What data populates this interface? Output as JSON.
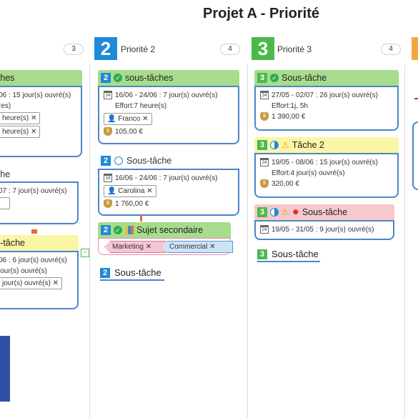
{
  "title": "Projet A - Priorité",
  "columns": [
    {
      "label": "",
      "count": "3"
    },
    {
      "badge": "2",
      "label": "Priorité 2",
      "count": "4"
    },
    {
      "badge": "3",
      "label": "Priorité 3",
      "count": "4"
    }
  ],
  "col1": {
    "card1": {
      "title": "ches",
      "dates": "06 : 15 jour(s) ouvré(s)",
      "line2": "res)",
      "chip1": "heure(s)",
      "chip2": "heure(s)"
    },
    "card2": {
      "title": "che",
      "dates": "07 : 7 jour(s) ouvré(s)"
    },
    "card3": {
      "title": "s-tâche",
      "dates": "06 : 6 jour(s) ouvré(s)",
      "line2": "jour(s) ouvré(s)",
      "chip": "jour(s) ouvré(s)"
    }
  },
  "col2": {
    "card1": {
      "badge": "2",
      "title": "sous-tâches",
      "dates": "16/06 - 24/06 : 7 jour(s) ouvré(s)",
      "effort": "Effort:7 heure(s)",
      "person": "Franco",
      "cost": "105,00 €"
    },
    "card2": {
      "badge": "2",
      "title": "Sous-tâche",
      "dates": "16/06 - 24/06 : 7 jour(s) ouvré(s)",
      "person": "Carolina",
      "cost": "1 760,00 €"
    },
    "card3": {
      "badge": "2",
      "title": "Sujet secondaire",
      "tag1": "Marketing",
      "tag2": "Commercial"
    },
    "plain": {
      "badge": "2",
      "title": "Sous-tâche"
    }
  },
  "col3": {
    "card1": {
      "badge": "3",
      "title": "Sous-tâche",
      "dates": "27/05 - 02/07 : 26 jour(s) ouvré(s)",
      "effort": "Effort:1j, 5h",
      "cost": "1 390,00 €"
    },
    "card2": {
      "badge": "3",
      "title": "Tâche 2",
      "dates": "19/05 - 08/06 : 15 jour(s) ouvré(s)",
      "effort": "Effort:4 jour(s) ouvré(s)",
      "cost": "320,00 €"
    },
    "card3": {
      "badge": "3",
      "title": "Sous-tâche",
      "dates": "19/05 - 31/05 : 9 jour(s) ouvré(s)"
    },
    "plain": {
      "badge": "3",
      "title": "Sous-tâche"
    }
  },
  "colors": {
    "priority2": "#1f8ad7",
    "priority3": "#4cb94a",
    "header_green": "#a7dc8e",
    "header_yellow": "#fbf5a6",
    "header_pink": "#f6c9cc",
    "border_blue": "#4a86c8"
  }
}
